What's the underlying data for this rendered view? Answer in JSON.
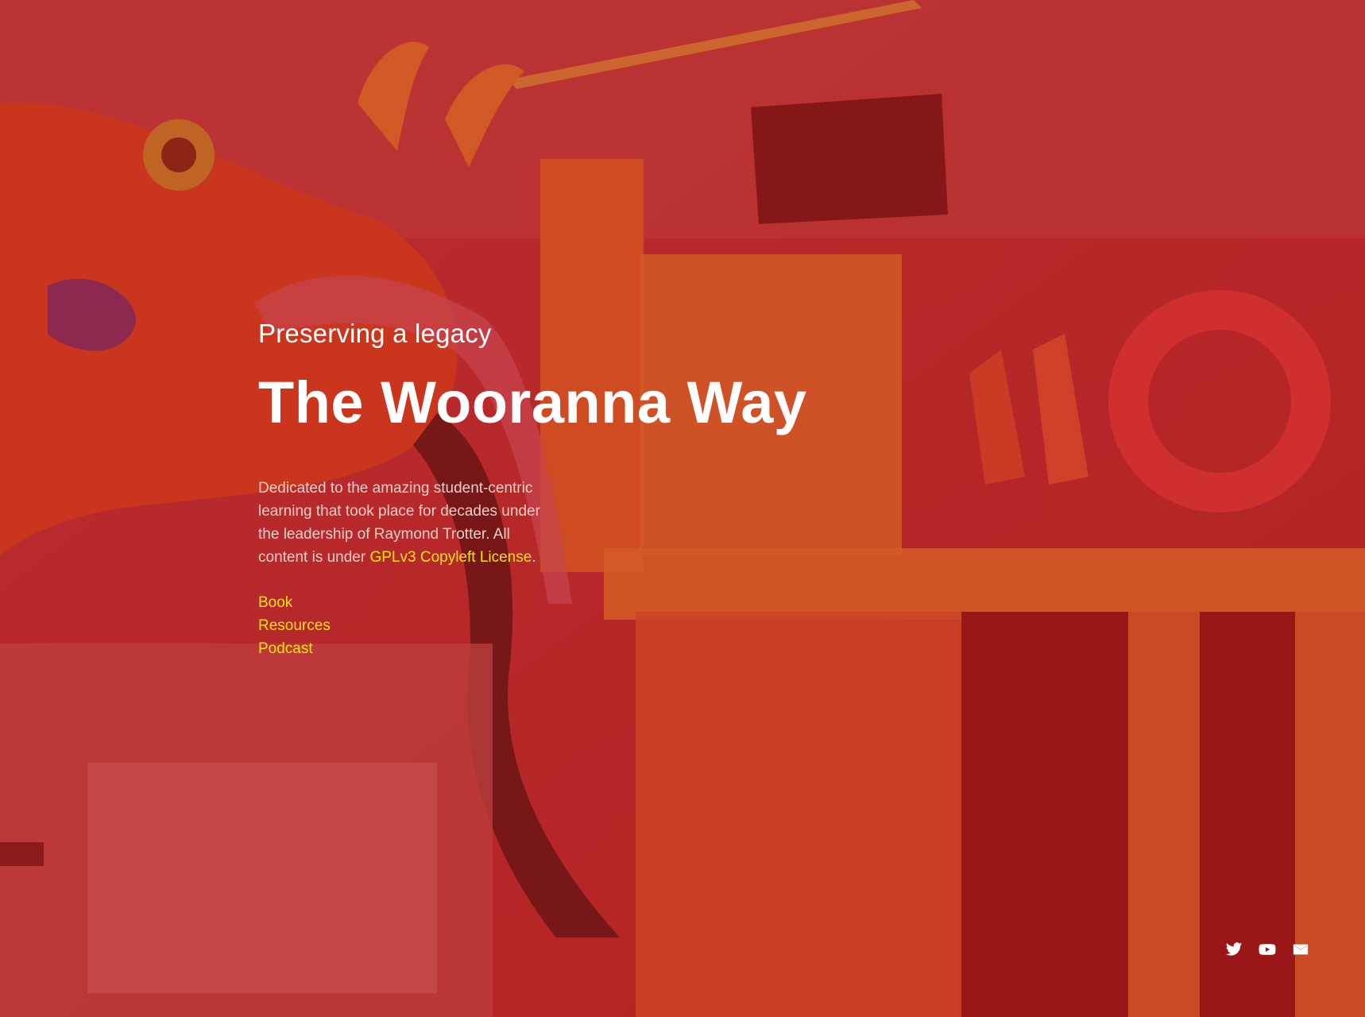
{
  "hero": {
    "subtitle": "Preserving a legacy",
    "title": "The Wooranna Way",
    "description_prefix": "Dedicated to the amazing student-centric learning that took place for decades under the leadership of Raymond Trotter. All content is under ",
    "license_link": "GPLv3 Copyleft License",
    "description_suffix": "."
  },
  "nav": {
    "links": [
      {
        "label": "Book"
      },
      {
        "label": "Resources"
      },
      {
        "label": "Podcast"
      }
    ]
  },
  "social": {
    "icons": [
      "twitter-icon",
      "youtube-icon",
      "mail-icon"
    ]
  },
  "colors": {
    "overlay": "#b21e1e",
    "link": "#ffe11a",
    "heading": "#ffffff",
    "body_text": "#f0cfc8"
  }
}
